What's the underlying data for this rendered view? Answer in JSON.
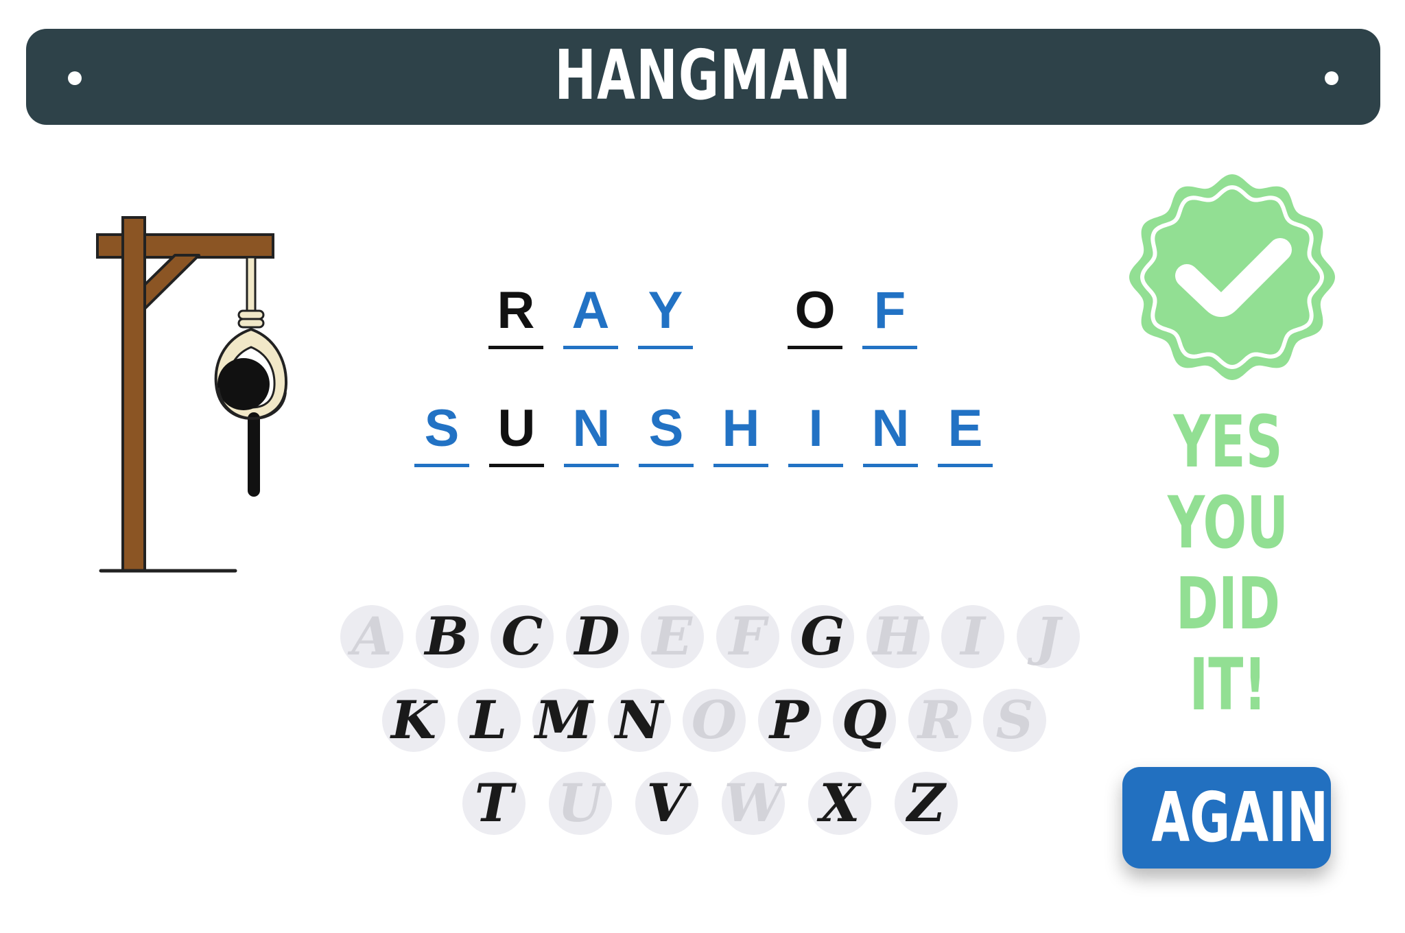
{
  "header": {
    "title": "HANGMAN"
  },
  "puzzle": {
    "rows": [
      [
        {
          "letter": "R",
          "state": "guessed"
        },
        {
          "letter": "A",
          "state": "revealed"
        },
        {
          "letter": "Y",
          "state": "revealed"
        },
        null,
        {
          "letter": "O",
          "state": "guessed"
        },
        {
          "letter": "F",
          "state": "revealed"
        }
      ],
      [
        {
          "letter": "S",
          "state": "revealed"
        },
        {
          "letter": "U",
          "state": "guessed"
        },
        {
          "letter": "N",
          "state": "revealed"
        },
        {
          "letter": "S",
          "state": "revealed"
        },
        {
          "letter": "H",
          "state": "revealed"
        },
        {
          "letter": "I",
          "state": "revealed"
        },
        {
          "letter": "N",
          "state": "revealed"
        },
        {
          "letter": "E",
          "state": "revealed"
        }
      ]
    ]
  },
  "keyboard": {
    "rows": [
      [
        {
          "letter": "A",
          "used": true
        },
        {
          "letter": "B",
          "used": false
        },
        {
          "letter": "C",
          "used": false
        },
        {
          "letter": "D",
          "used": false
        },
        {
          "letter": "E",
          "used": true
        },
        {
          "letter": "F",
          "used": true
        },
        {
          "letter": "G",
          "used": false
        },
        {
          "letter": "H",
          "used": true
        },
        {
          "letter": "I",
          "used": true
        },
        {
          "letter": "J",
          "used": true
        }
      ],
      [
        {
          "letter": "K",
          "used": false
        },
        {
          "letter": "L",
          "used": false
        },
        {
          "letter": "M",
          "used": false
        },
        {
          "letter": "N",
          "used": false
        },
        {
          "letter": "O",
          "used": true
        },
        {
          "letter": "P",
          "used": false
        },
        {
          "letter": "Q",
          "used": false
        },
        {
          "letter": "R",
          "used": true
        },
        {
          "letter": "S",
          "used": true
        }
      ],
      [
        {
          "letter": "T",
          "used": false
        },
        {
          "letter": "U",
          "used": true
        },
        {
          "letter": "V",
          "used": false
        },
        {
          "letter": "W",
          "used": true
        },
        {
          "letter": "X",
          "used": false
        },
        {
          "letter": "Z",
          "used": false
        }
      ]
    ]
  },
  "result": {
    "icon": "check-badge-icon",
    "lines": [
      "YES",
      "YOU",
      "DID",
      "IT!"
    ],
    "again_label": "AGAIN"
  },
  "colors": {
    "header_bg": "#2e4249",
    "revealed": "#2272c4",
    "guessed": "#111111",
    "success_green": "#92df93",
    "button_blue": "#2270c0",
    "key_bg": "#ececf1",
    "key_used_text": "#d3d3d9"
  }
}
